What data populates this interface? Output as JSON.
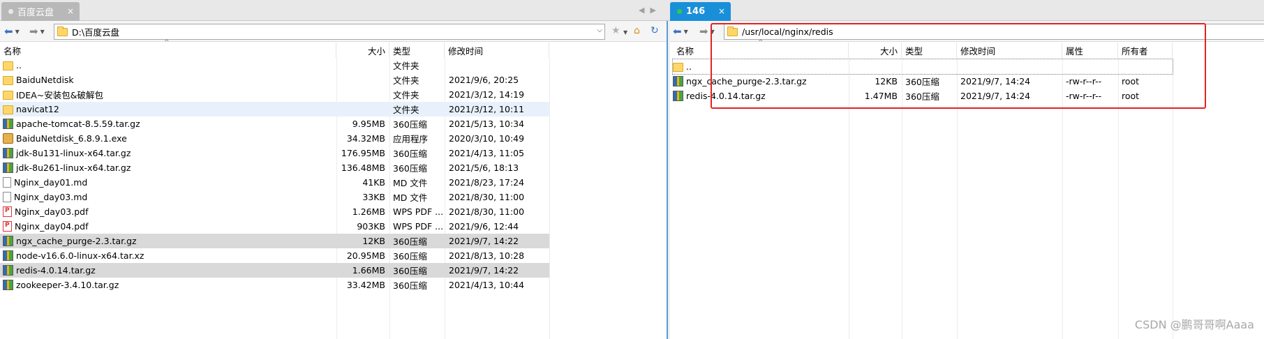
{
  "tabs": {
    "local": {
      "label": "百度云盘",
      "close": "×"
    },
    "remote": {
      "label": "146",
      "close": "×"
    }
  },
  "left_address": {
    "path": "D:\\百度云盘"
  },
  "right_address": {
    "path": "/usr/local/nginx/redis"
  },
  "left_pane": {
    "headers": {
      "name": "名称",
      "size": "大小",
      "type": "类型",
      "mtime": "修改时间"
    },
    "rows": [
      {
        "icon": "folder",
        "name": "..",
        "size": "",
        "type": "文件夹",
        "mtime": "",
        "state": ""
      },
      {
        "icon": "folder",
        "name": "BaiduNetdisk",
        "size": "",
        "type": "文件夹",
        "mtime": "2021/9/6, 20:25",
        "state": ""
      },
      {
        "icon": "folder",
        "name": "IDEA~安装包&破解包",
        "size": "",
        "type": "文件夹",
        "mtime": "2021/3/12, 14:19",
        "state": ""
      },
      {
        "icon": "folder",
        "name": "navicat12",
        "size": "",
        "type": "文件夹",
        "mtime": "2021/3/12, 10:11",
        "state": "hover"
      },
      {
        "icon": "archive",
        "name": "apache-tomcat-8.5.59.tar.gz",
        "size": "9.95MB",
        "type": "360压缩",
        "mtime": "2021/5/13, 10:34",
        "state": ""
      },
      {
        "icon": "exe",
        "name": "BaiduNetdisk_6.8.9.1.exe",
        "size": "34.32MB",
        "type": "应用程序",
        "mtime": "2020/3/10, 10:49",
        "state": ""
      },
      {
        "icon": "archive",
        "name": "jdk-8u131-linux-x64.tar.gz",
        "size": "176.95MB",
        "type": "360压缩",
        "mtime": "2021/4/13, 11:05",
        "state": ""
      },
      {
        "icon": "archive",
        "name": "jdk-8u261-linux-x64.tar.gz",
        "size": "136.48MB",
        "type": "360压缩",
        "mtime": "2021/5/6, 18:13",
        "state": ""
      },
      {
        "icon": "md",
        "name": "Nginx_day01.md",
        "size": "41KB",
        "type": "MD 文件",
        "mtime": "2021/8/23, 17:24",
        "state": ""
      },
      {
        "icon": "md",
        "name": "Nginx_day03.md",
        "size": "33KB",
        "type": "MD 文件",
        "mtime": "2021/8/30, 11:00",
        "state": ""
      },
      {
        "icon": "pdf",
        "name": "Nginx_day03.pdf",
        "size": "1.26MB",
        "type": "WPS PDF ...",
        "mtime": "2021/8/30, 11:00",
        "state": ""
      },
      {
        "icon": "pdf",
        "name": "Nginx_day04.pdf",
        "size": "903KB",
        "type": "WPS PDF ...",
        "mtime": "2021/9/6, 12:44",
        "state": ""
      },
      {
        "icon": "archive",
        "name": "ngx_cache_purge-2.3.tar.gz",
        "size": "12KB",
        "type": "360压缩",
        "mtime": "2021/9/7, 14:22",
        "state": "sel"
      },
      {
        "icon": "archive",
        "name": "node-v16.6.0-linux-x64.tar.xz",
        "size": "20.95MB",
        "type": "360压缩",
        "mtime": "2021/8/13, 10:28",
        "state": ""
      },
      {
        "icon": "archive",
        "name": "redis-4.0.14.tar.gz",
        "size": "1.66MB",
        "type": "360压缩",
        "mtime": "2021/9/7, 14:22",
        "state": "sel"
      },
      {
        "icon": "archive",
        "name": "zookeeper-3.4.10.tar.gz",
        "size": "33.42MB",
        "type": "360压缩",
        "mtime": "2021/4/13, 10:44",
        "state": ""
      }
    ]
  },
  "right_pane": {
    "headers": {
      "name": "名称",
      "size": "大小",
      "type": "类型",
      "mtime": "修改时间",
      "attr": "属性",
      "owner": "所有者"
    },
    "rows": [
      {
        "icon": "folder",
        "name": "..",
        "size": "",
        "type": "",
        "mtime": "",
        "attr": "",
        "owner": "",
        "state": "dash"
      },
      {
        "icon": "archive",
        "name": "ngx_cache_purge-2.3.tar.gz",
        "size": "12KB",
        "type": "360压缩",
        "mtime": "2021/9/7, 14:24",
        "attr": "-rw-r--r--",
        "owner": "root",
        "state": ""
      },
      {
        "icon": "archive",
        "name": "redis-4.0.14.tar.gz",
        "size": "1.47MB",
        "type": "360压缩",
        "mtime": "2021/9/7, 14:24",
        "attr": "-rw-r--r--",
        "owner": "root",
        "state": ""
      }
    ]
  },
  "watermark": "CSDN @鹏哥哥啊Aaaa",
  "colors": {
    "accent": "#1a8fd9",
    "highlight_box": "#e32222",
    "selected_row": "#d9d9d9"
  }
}
